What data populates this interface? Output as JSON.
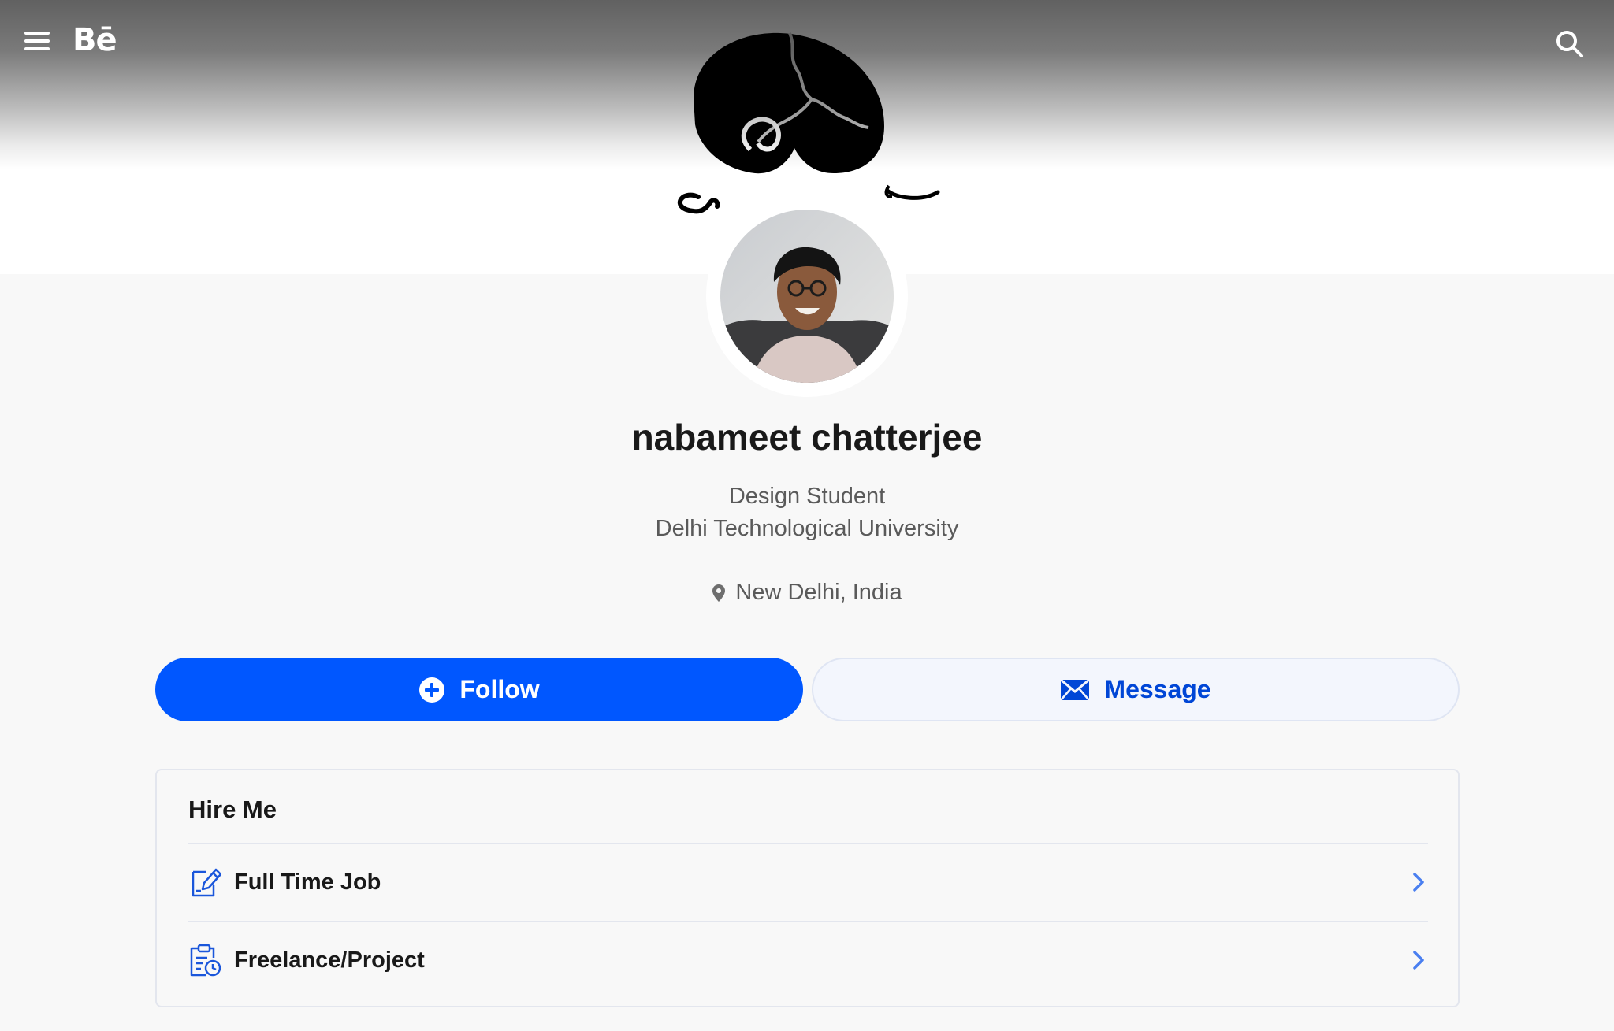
{
  "header": {
    "logo_text": "Bē",
    "menu_icon": "hamburger-menu-icon",
    "search_icon": "search-icon"
  },
  "banner": {
    "art_description_icon": "ink-swirl-artwork"
  },
  "profile": {
    "name": "nabameet chatterjee",
    "occupation": "Design Student",
    "company": "Delhi Technological University",
    "location": "New Delhi, India",
    "location_icon": "location-pin-icon"
  },
  "actions": {
    "follow_label": "Follow",
    "follow_icon": "plus-circle-icon",
    "message_label": "Message",
    "message_icon": "envelope-icon"
  },
  "hire_me": {
    "title": "Hire Me",
    "items": [
      {
        "label": "Full Time Job",
        "icon": "pencil-document-icon"
      },
      {
        "label": "Freelance/Project",
        "icon": "clipboard-clock-icon"
      }
    ]
  },
  "colors": {
    "primary_blue": "#0057ff",
    "message_text": "#0046d6",
    "icon_blue": "#1a56db",
    "page_bg": "#f8f8f8"
  }
}
